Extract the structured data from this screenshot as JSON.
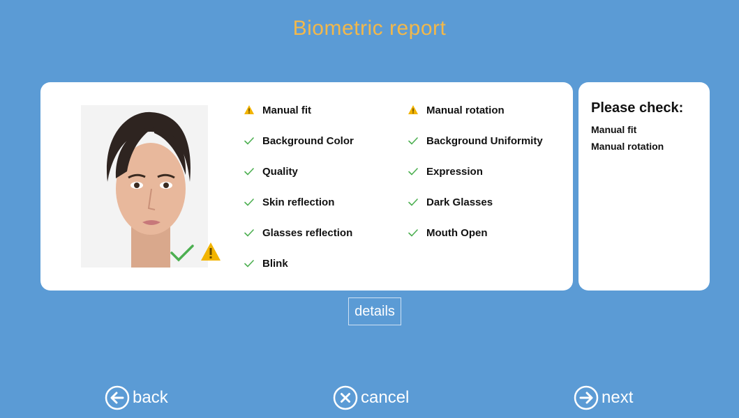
{
  "title": "Biometric report",
  "checks_left": [
    {
      "status": "warning",
      "label": "Manual fit"
    },
    {
      "status": "ok",
      "label": "Background Color"
    },
    {
      "status": "ok",
      "label": "Quality"
    },
    {
      "status": "ok",
      "label": "Skin reflection"
    },
    {
      "status": "ok",
      "label": "Glasses reflection"
    },
    {
      "status": "ok",
      "label": "Blink"
    }
  ],
  "checks_right": [
    {
      "status": "warning",
      "label": "Manual rotation"
    },
    {
      "status": "ok",
      "label": "Background Uniformity"
    },
    {
      "status": "ok",
      "label": "Expression"
    },
    {
      "status": "ok",
      "label": "Dark Glasses"
    },
    {
      "status": "ok",
      "label": "Mouth Open"
    }
  ],
  "side_panel": {
    "title": "Please check:",
    "items": [
      "Manual fit",
      "Manual rotation"
    ]
  },
  "details_label": "details",
  "nav": {
    "back_label": "back",
    "cancel_label": "cancel",
    "next_label": "next"
  },
  "colors": {
    "background": "#5b9bd5",
    "title": "#f2b84b",
    "ok": "#4caf50",
    "warning": "#f2b400"
  }
}
